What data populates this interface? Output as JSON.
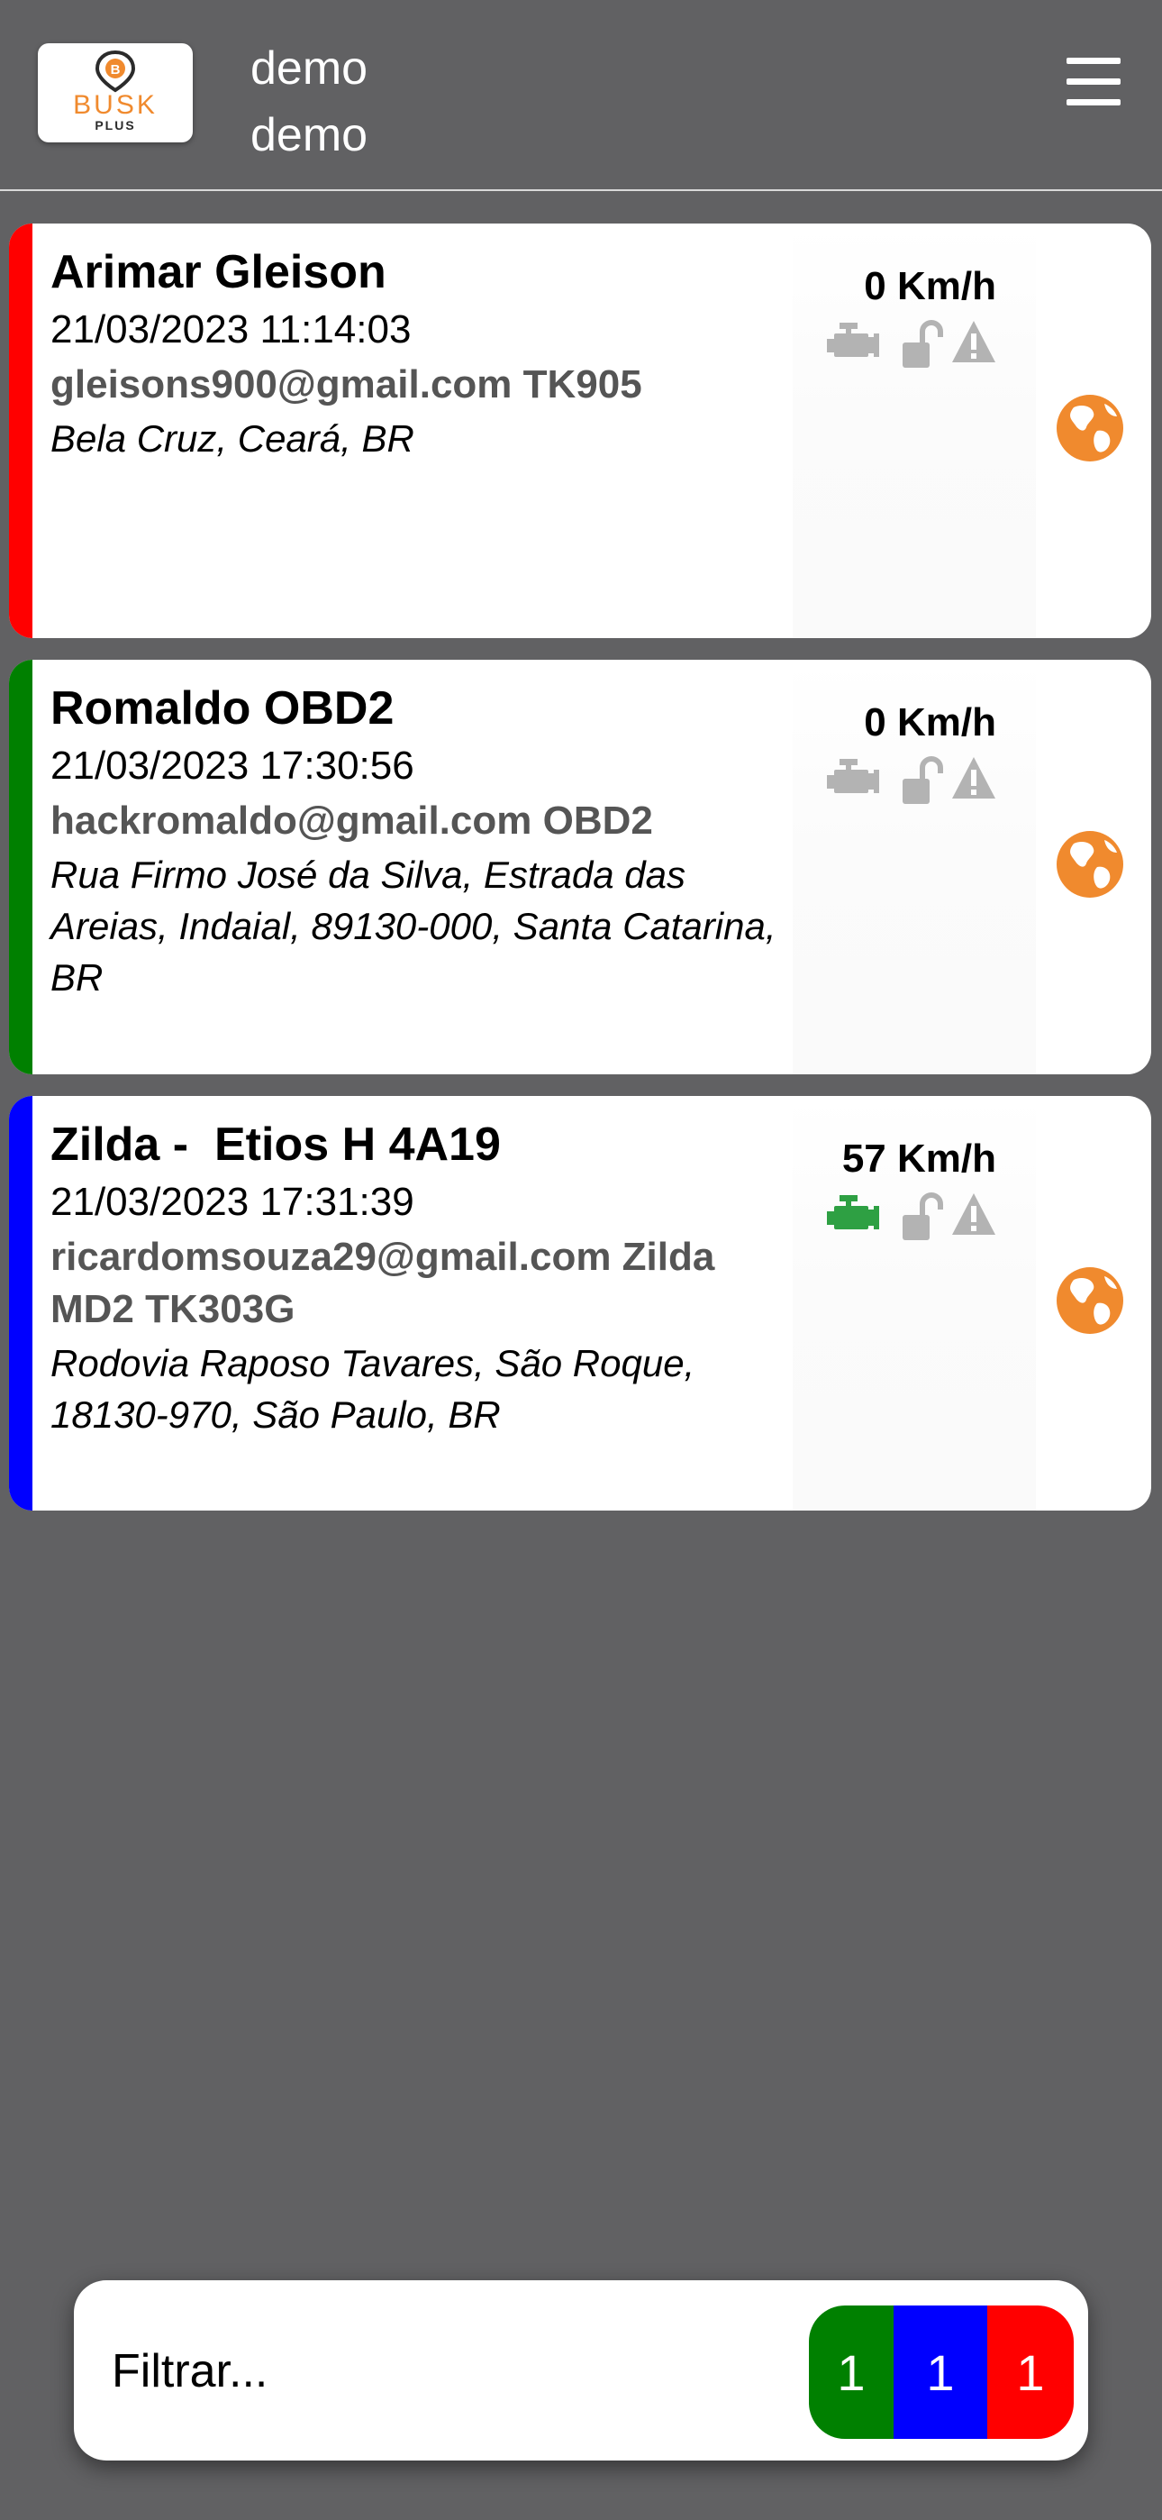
{
  "header": {
    "logo": {
      "brand": "BUSK",
      "sub": "PLUS",
      "mark": "B"
    },
    "user_line1": "demo",
    "user_line2": "demo",
    "menu_icon": "hamburger-menu-icon"
  },
  "colors": {
    "background": "#616163",
    "card": "#ffffff",
    "engine_off": "#b3b3b3",
    "engine_on": "#2ea043",
    "globe": "#f08a2e",
    "counter_green": "#008000",
    "counter_blue": "#0000ff",
    "counter_red": "#ff0000"
  },
  "vehicles": [
    {
      "name": "Arimar Gleison",
      "datetime": "21/03/2023 11:14:03",
      "device": "gleisons900@gmail.com TK905",
      "address": "Bela Cruz, Ceará, BR",
      "speed": "0 Km/h",
      "status_color": "#ff0000",
      "engine_on": false,
      "icons": [
        "engine-icon",
        "unlocked-padlock-icon",
        "warning-icon",
        "globe-icon"
      ]
    },
    {
      "name": "Romaldo OBD2",
      "datetime": "21/03/2023 17:30:56",
      "device": "hackromaldo@gmail.com OBD2",
      "address": "Rua Firmo José da Silva, Estrada das Areias, Indaial, 89130-000, Santa Catarina, BR",
      "speed": "0 Km/h",
      "status_color": "#008000",
      "engine_on": false,
      "icons": [
        "engine-icon",
        "unlocked-padlock-icon",
        "warning-icon",
        "globe-icon"
      ]
    },
    {
      "name": "Zilda -  Etios H 4A19",
      "datetime": "21/03/2023 17:31:39",
      "device": "ricardomsouza29@gmail.com Zilda MD2 TK303G",
      "address": "Rodovia Raposo Tavares, São Roque, 18130-970, São Paulo, BR",
      "speed": "57 Km/h",
      "status_color": "#0000ff",
      "engine_on": true,
      "icons": [
        "engine-icon",
        "unlocked-padlock-icon",
        "warning-icon",
        "globe-icon"
      ]
    }
  ],
  "filter": {
    "placeholder": "Filtrar...",
    "counters": [
      {
        "value": "1",
        "color": "green"
      },
      {
        "value": "1",
        "color": "blue"
      },
      {
        "value": "1",
        "color": "red"
      }
    ]
  }
}
